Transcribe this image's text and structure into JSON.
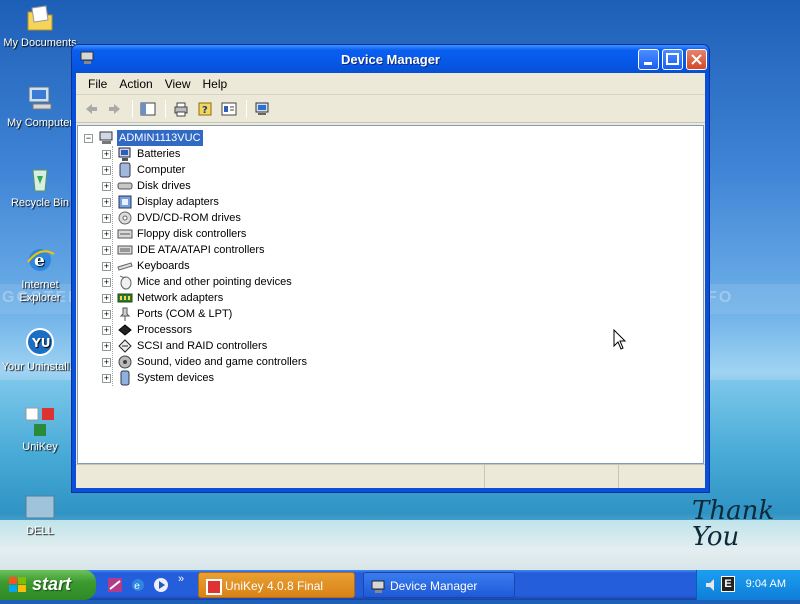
{
  "desktop": {
    "icons": [
      {
        "label": "My Documents"
      },
      {
        "label": "My Computer"
      },
      {
        "label": "Recycle Bin"
      },
      {
        "label": "Internet Explorer"
      },
      {
        "label": "Your Uninstall..."
      },
      {
        "label": "UniKey"
      },
      {
        "label": "DELL"
      }
    ],
    "watermark": "GOSTEP.INFO",
    "thank_you": "Thank You"
  },
  "window": {
    "title": "Device Manager",
    "menu": [
      "File",
      "Action",
      "View",
      "Help"
    ],
    "toolbar_icons": [
      "back-icon",
      "forward-icon",
      "show-hide-tree-icon",
      "print-icon",
      "help-icon",
      "properties-icon",
      "scan-hardware-icon"
    ],
    "tree": {
      "root": "ADMIN1113VUC",
      "items": [
        {
          "label": "Batteries",
          "icon": "battery-icon"
        },
        {
          "label": "Computer",
          "icon": "computer-icon"
        },
        {
          "label": "Disk drives",
          "icon": "disk-drive-icon"
        },
        {
          "label": "Display adapters",
          "icon": "display-adapter-icon"
        },
        {
          "label": "DVD/CD-ROM drives",
          "icon": "dvd-icon"
        },
        {
          "label": "Floppy disk controllers",
          "icon": "floppy-controller-icon"
        },
        {
          "label": "IDE ATA/ATAPI controllers",
          "icon": "ide-controller-icon"
        },
        {
          "label": "Keyboards",
          "icon": "keyboard-icon"
        },
        {
          "label": "Mice and other pointing devices",
          "icon": "mouse-icon"
        },
        {
          "label": "Network adapters",
          "icon": "network-adapter-icon"
        },
        {
          "label": "Ports (COM & LPT)",
          "icon": "port-icon"
        },
        {
          "label": "Processors",
          "icon": "processor-icon"
        },
        {
          "label": "SCSI and RAID controllers",
          "icon": "scsi-icon"
        },
        {
          "label": "Sound, video and game controllers",
          "icon": "sound-icon"
        },
        {
          "label": "System devices",
          "icon": "system-devices-icon"
        }
      ]
    }
  },
  "taskbar": {
    "start_label": "start",
    "tasks": [
      {
        "label": "UniKey 4.0.8 Final"
      },
      {
        "label": "Device Manager"
      }
    ],
    "tray_time": "9:04 AM",
    "tray_letter": "E"
  }
}
